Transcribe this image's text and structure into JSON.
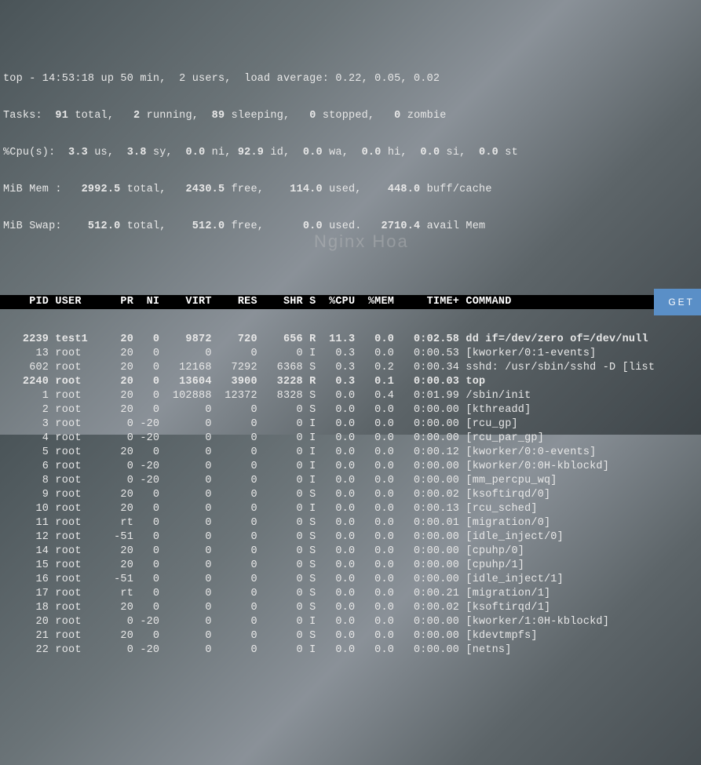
{
  "header": {
    "line1": "top - 14:53:18 up 50 min,  2 users,  load average: 0.22, 0.05, 0.02",
    "tasks_label": "Tasks:",
    "tasks_total": "  91 ",
    "tasks_total_lbl": "total,",
    "tasks_running": "   2 ",
    "tasks_running_lbl": "running,",
    "tasks_sleeping": "  89 ",
    "tasks_sleeping_lbl": "sleeping,",
    "tasks_stopped": "   0 ",
    "tasks_stopped_lbl": "stopped,",
    "tasks_zombie": "   0 ",
    "tasks_zombie_lbl": "zombie",
    "cpu_label": "%Cpu(s):",
    "cpu_us": "  3.3 ",
    "cpu_us_lbl": "us,",
    "cpu_sy": "  3.8 ",
    "cpu_sy_lbl": "sy,",
    "cpu_ni": "  0.0 ",
    "cpu_ni_lbl": "ni,",
    "cpu_id": " 92.9 ",
    "cpu_id_lbl": "id,",
    "cpu_wa": "  0.0 ",
    "cpu_wa_lbl": "wa,",
    "cpu_hi": "  0.0 ",
    "cpu_hi_lbl": "hi,",
    "cpu_si": "  0.0 ",
    "cpu_si_lbl": "si,",
    "cpu_st": "  0.0 ",
    "cpu_st_lbl": "st",
    "mem_label": "MiB Mem :",
    "mem_total": "   2992.5 ",
    "mem_total_lbl": "total,",
    "mem_free": "   2430.5 ",
    "mem_free_lbl": "free,",
    "mem_used": "    114.0 ",
    "mem_used_lbl": "used,",
    "mem_buff": "    448.0 ",
    "mem_buff_lbl": "buff/cache",
    "swap_label": "MiB Swap:",
    "swap_total": "    512.0 ",
    "swap_total_lbl": "total,",
    "swap_free": "    512.0 ",
    "swap_free_lbl": "free,",
    "swap_used": "      0.0 ",
    "swap_used_lbl": "used.",
    "swap_avail": "   2710.4 ",
    "swap_avail_lbl": "avail Mem"
  },
  "columns": "    PID USER      PR  NI    VIRT    RES    SHR S  %CPU  %MEM     TIME+ COMMAND          ",
  "processes": [
    {
      "bold": true,
      "text": "   2239 test1     20   0    9872    720    656 R  11.3   0.0   0:02.58 dd if=/dev/zero of=/dev/null"
    },
    {
      "bold": false,
      "text": "     13 root      20   0       0      0      0 I   0.3   0.0   0:00.53 [kworker/0:1-events]"
    },
    {
      "bold": false,
      "text": "    602 root      20   0   12168   7292   6368 S   0.3   0.2   0:00.34 sshd: /usr/sbin/sshd -D [list"
    },
    {
      "bold": true,
      "text": "   2240 root      20   0   13604   3900   3228 R   0.3   0.1   0:00.03 top"
    },
    {
      "bold": false,
      "text": "      1 root      20   0  102888  12372   8328 S   0.0   0.4   0:01.99 /sbin/init"
    },
    {
      "bold": false,
      "text": "      2 root      20   0       0      0      0 S   0.0   0.0   0:00.00 [kthreadd]"
    },
    {
      "bold": false,
      "text": "      3 root       0 -20       0      0      0 I   0.0   0.0   0:00.00 [rcu_gp]"
    },
    {
      "bold": false,
      "text": "      4 root       0 -20       0      0      0 I   0.0   0.0   0:00.00 [rcu_par_gp]"
    },
    {
      "bold": false,
      "text": "      5 root      20   0       0      0      0 I   0.0   0.0   0:00.12 [kworker/0:0-events]"
    },
    {
      "bold": false,
      "text": "      6 root       0 -20       0      0      0 I   0.0   0.0   0:00.00 [kworker/0:0H-kblockd]"
    },
    {
      "bold": false,
      "text": "      8 root       0 -20       0      0      0 I   0.0   0.0   0:00.00 [mm_percpu_wq]"
    },
    {
      "bold": false,
      "text": "      9 root      20   0       0      0      0 S   0.0   0.0   0:00.02 [ksoftirqd/0]"
    },
    {
      "bold": false,
      "text": "     10 root      20   0       0      0      0 I   0.0   0.0   0:00.13 [rcu_sched]"
    },
    {
      "bold": false,
      "text": "     11 root      rt   0       0      0      0 S   0.0   0.0   0:00.01 [migration/0]"
    },
    {
      "bold": false,
      "text": "     12 root     -51   0       0      0      0 S   0.0   0.0   0:00.00 [idle_inject/0]"
    },
    {
      "bold": false,
      "text": "     14 root      20   0       0      0      0 S   0.0   0.0   0:00.00 [cpuhp/0]"
    },
    {
      "bold": false,
      "text": "     15 root      20   0       0      0      0 S   0.0   0.0   0:00.00 [cpuhp/1]"
    },
    {
      "bold": false,
      "text": "     16 root     -51   0       0      0      0 S   0.0   0.0   0:00.00 [idle_inject/1]"
    },
    {
      "bold": false,
      "text": "     17 root      rt   0       0      0      0 S   0.0   0.0   0:00.21 [migration/1]"
    },
    {
      "bold": false,
      "text": "     18 root      20   0       0      0      0 S   0.0   0.0   0:00.02 [ksoftirqd/1]"
    },
    {
      "bold": false,
      "text": "     20 root       0 -20       0      0      0 I   0.0   0.0   0:00.00 [kworker/1:0H-kblockd]"
    },
    {
      "bold": false,
      "text": "     21 root      20   0       0      0      0 S   0.0   0.0   0:00.00 [kdevtmpfs]"
    },
    {
      "bold": false,
      "text": "     22 root       0 -20       0      0      0 I   0.0   0.0   0:00.00 [netns]"
    }
  ],
  "watermark": "Nginx Hoa",
  "cta": "GET"
}
